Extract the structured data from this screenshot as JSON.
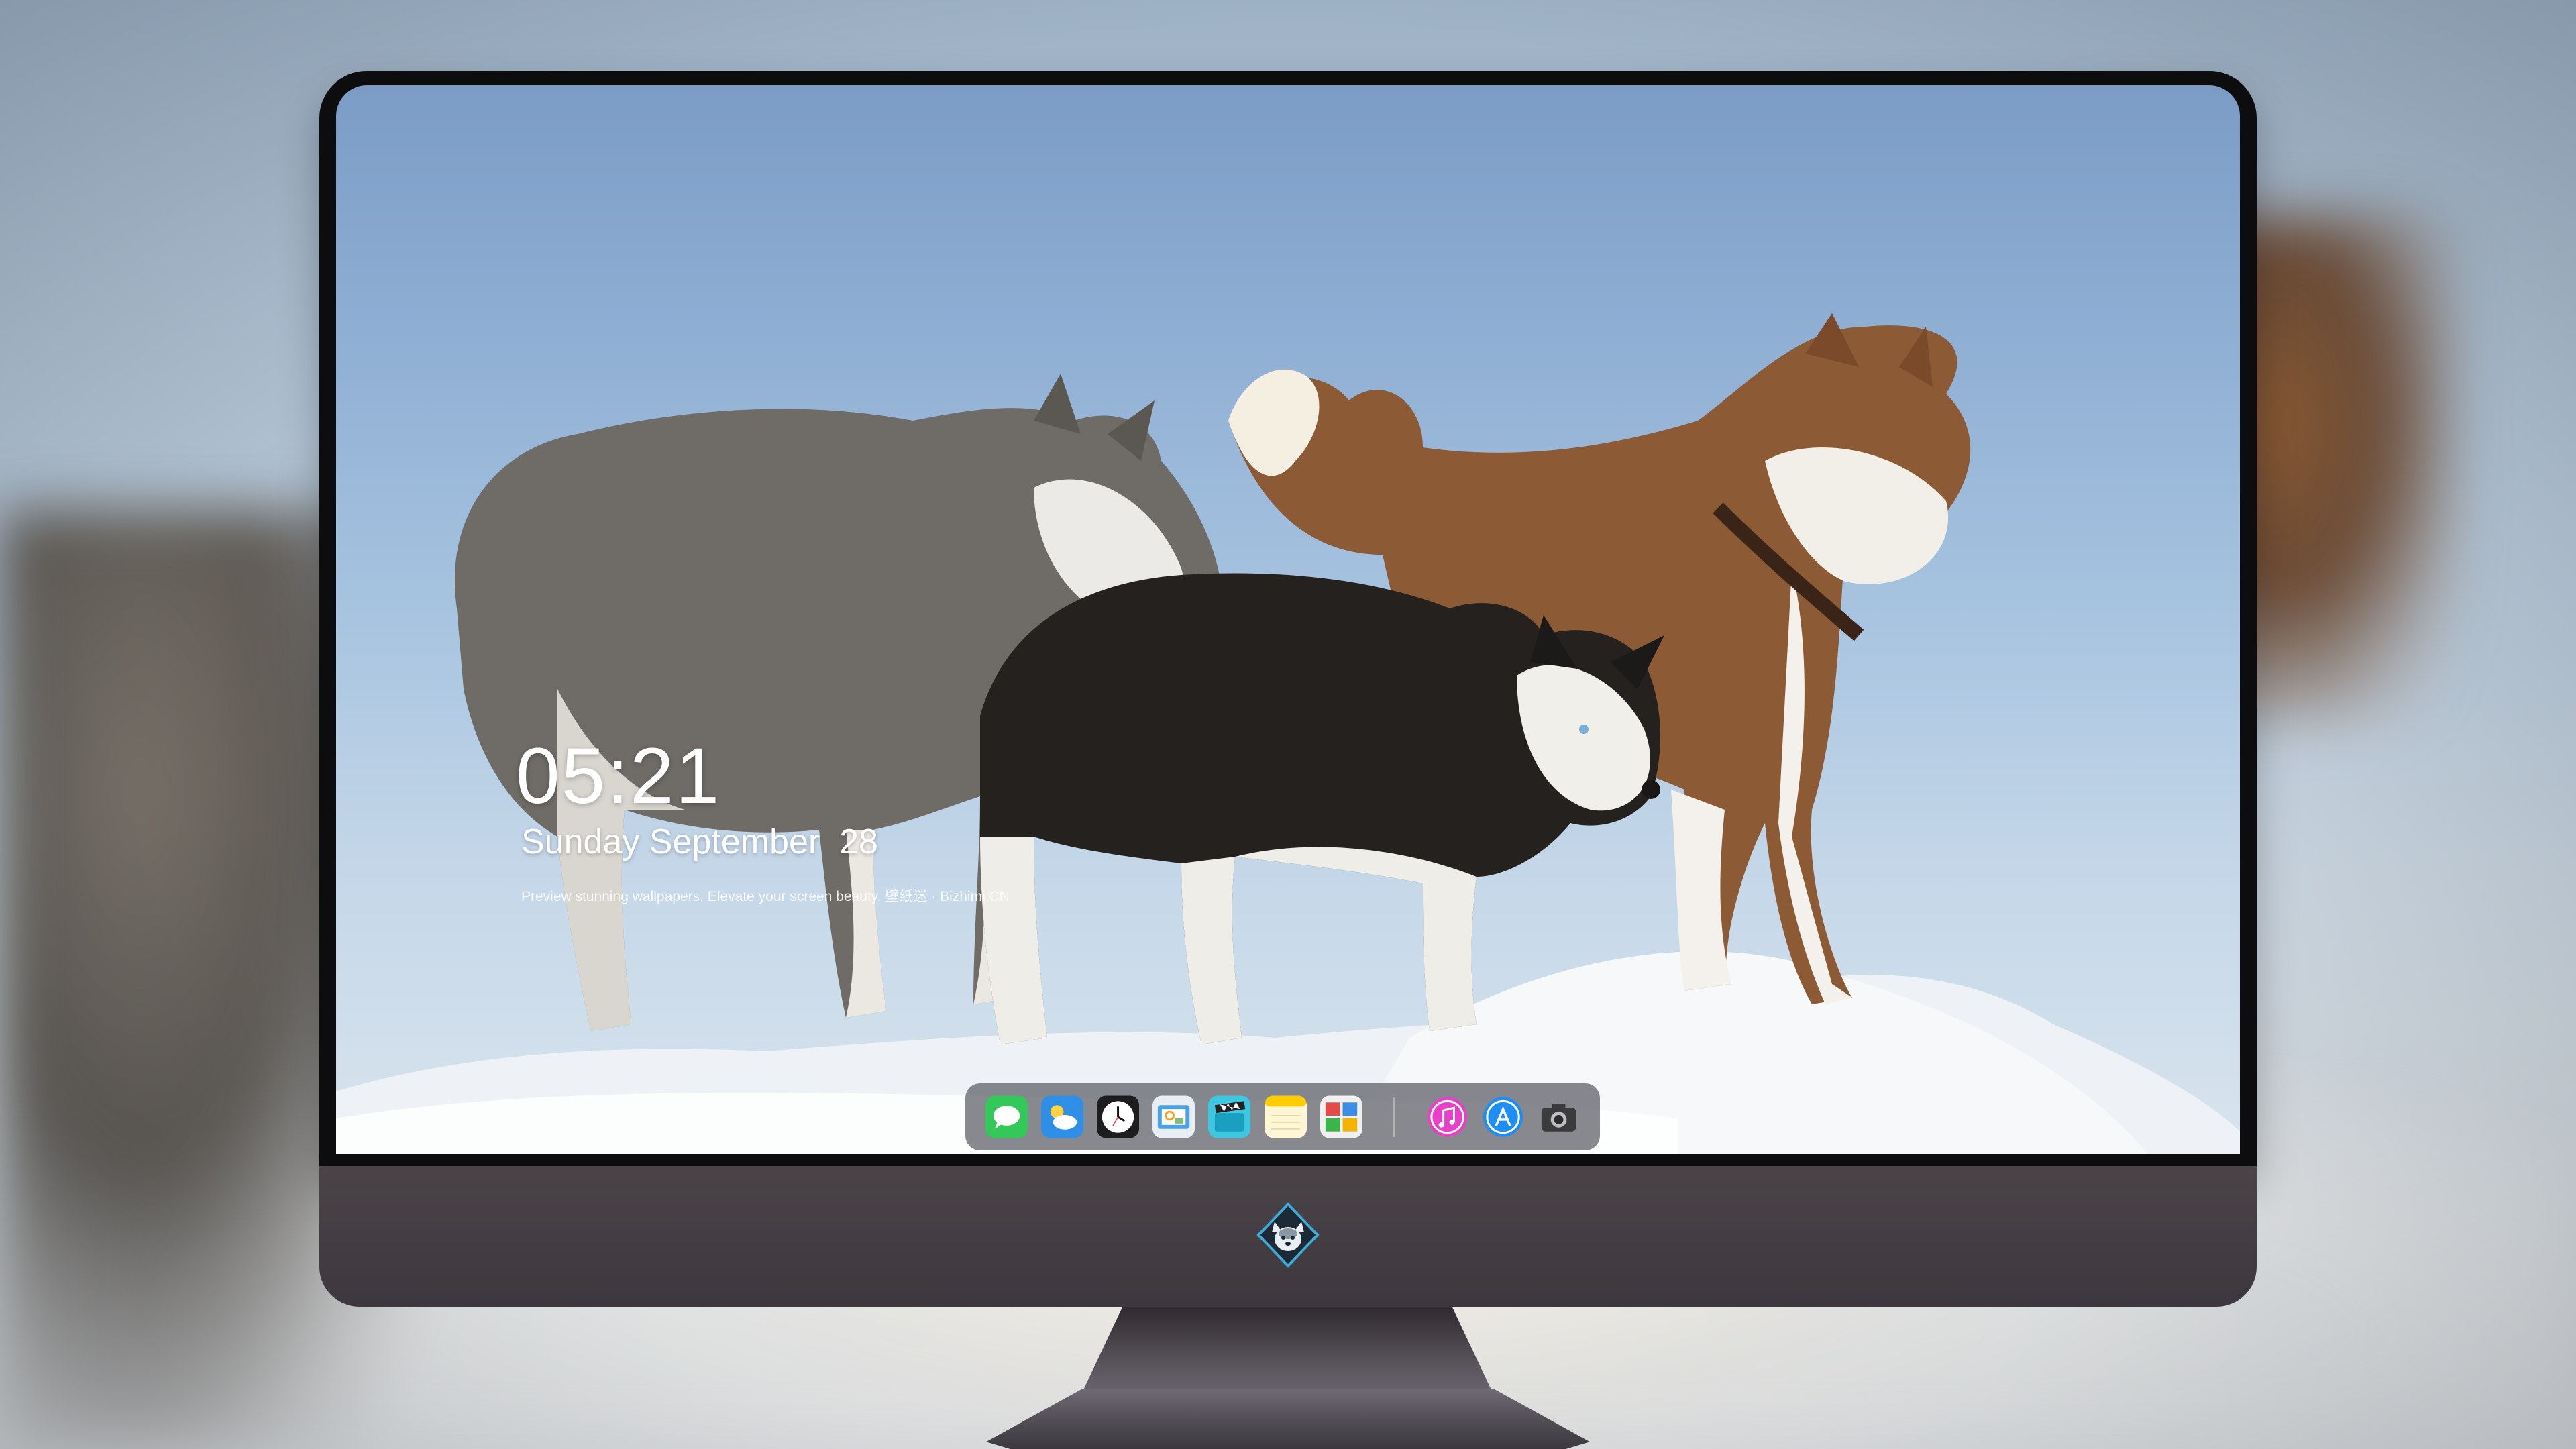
{
  "lock_screen": {
    "time": "05:21",
    "date": "Sunday September  28",
    "caption": "Preview stunning wallpapers. Elevate your screen beauty. 壁纸迷 · Bizhimi.CN"
  },
  "dock": {
    "apps": [
      "messages-icon",
      "weather-icon",
      "clock-icon",
      "preview-icon",
      "video-clapper-icon",
      "notes-icon",
      "photo-booth-icon"
    ],
    "apps_right": [
      "itunes-icon",
      "app-store-icon",
      "camera-icon"
    ]
  },
  "monitor": {
    "chin_logo": "husky-mascot-logo"
  },
  "colors": {
    "bezel": "#0d0d10",
    "chin": "#45403f",
    "dock": "#5a5c64",
    "sky": "#90b0d4"
  }
}
